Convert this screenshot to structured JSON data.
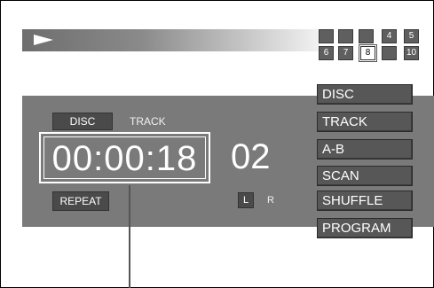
{
  "transport": {
    "play_icon": "play-icon"
  },
  "track_grid": {
    "row1": [
      "",
      "",
      "",
      "4",
      "5"
    ],
    "row2": [
      "6",
      "7",
      "8",
      "",
      "10"
    ],
    "current": "8"
  },
  "display": {
    "mode_selected": "DISC",
    "mode_other": "TRACK",
    "time": "00:00:18",
    "track_number": "02",
    "repeat_label": "REPEAT",
    "channel_left": "L",
    "channel_right": "R"
  },
  "mode_buttons": [
    "DISC",
    "TRACK",
    "A-B",
    "SCAN",
    "SHUFFLE",
    "PROGRAM"
  ]
}
